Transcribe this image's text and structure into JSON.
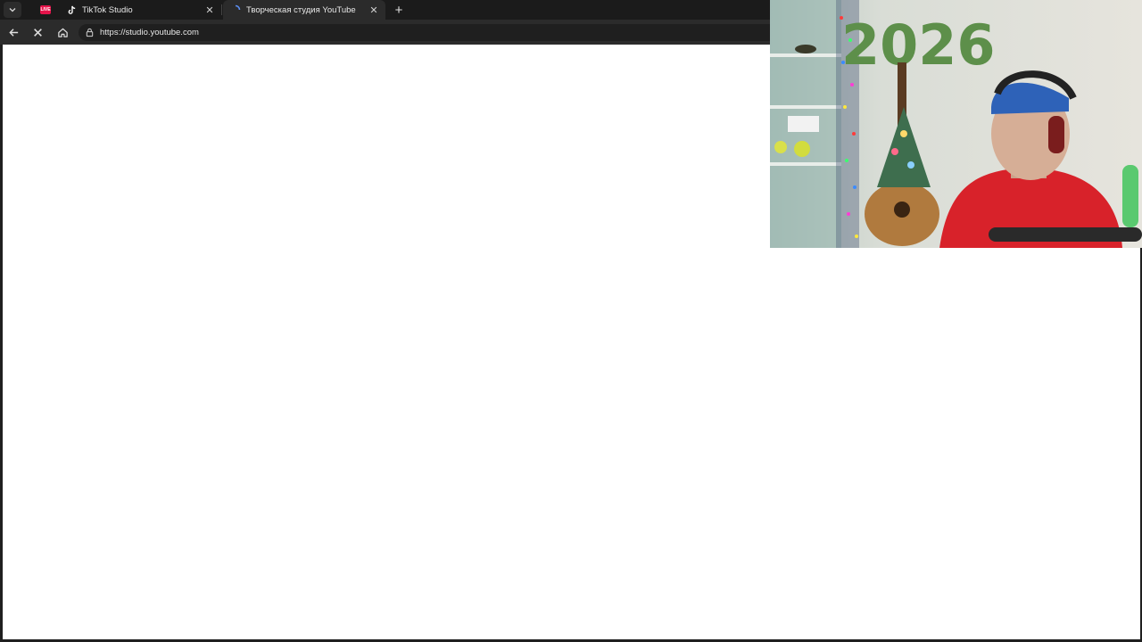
{
  "browser": {
    "tabs": [
      {
        "title": "TikTok Studio",
        "favicon": "tiktok-icon",
        "active": false
      },
      {
        "title": "Творческая студия YouTube",
        "favicon": "youtube-studio-loading-icon",
        "active": true
      }
    ],
    "pinned_tab": {
      "favicon": "live-badge-icon",
      "badge_text": "LIVE"
    },
    "url": "https://studio.youtube.com",
    "loading": true
  },
  "overlay": {
    "webcam": {
      "wall_decoration_text": "2026",
      "description_icon": "webcam-feed"
    }
  },
  "colors": {
    "tabbar_bg": "#1b1b1b",
    "toolbar_bg": "#2b2b2b",
    "page_bg": "#ffffff",
    "pinned_badge": "#e5134a"
  }
}
